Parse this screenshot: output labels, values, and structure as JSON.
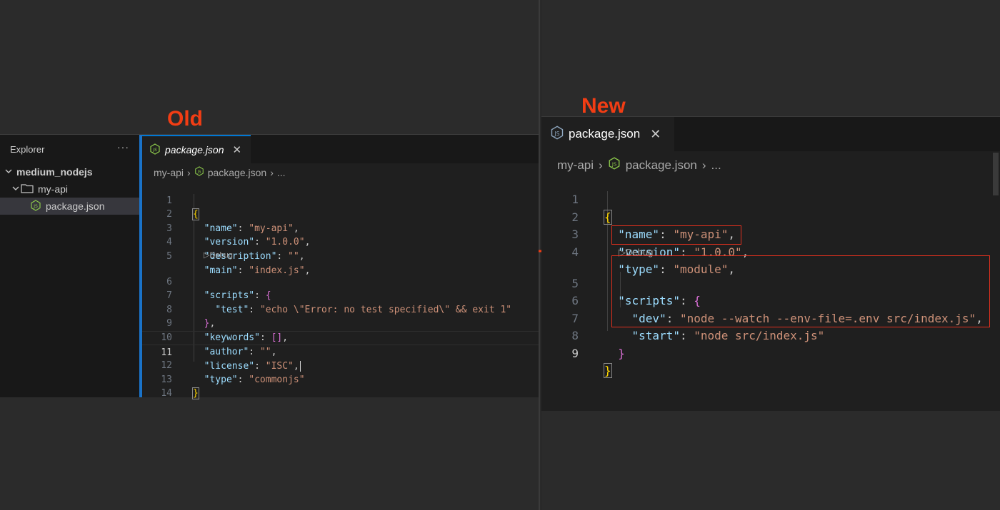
{
  "labels": {
    "old": "Old",
    "new": "New"
  },
  "colors": {
    "accent_label": "#f23d14",
    "highlight_box": "#e0301e",
    "tab_active_border": "#0078d4"
  },
  "old": {
    "explorer": {
      "title": "Explorer",
      "more": "···",
      "items": [
        {
          "label": "medium_nodejs",
          "type": "folder-root",
          "icon": "chevron-down-icon"
        },
        {
          "label": "my-api",
          "type": "folder",
          "icon": "folder-icon"
        },
        {
          "label": "package.json",
          "type": "file",
          "icon": "js-file-icon",
          "selected": true
        }
      ]
    },
    "tab": {
      "label": "package.json",
      "close": "✕",
      "icon": "js-file-icon"
    },
    "breadcrumb": [
      "my-api",
      "package.json",
      "..."
    ],
    "debug_label": "▷Debug",
    "lines": [
      "1",
      "2",
      "3",
      "4",
      "5",
      "6",
      "7",
      "8",
      "9",
      "10",
      "11",
      "12",
      "13",
      "14"
    ],
    "active_line": "11",
    "code": {
      "name_key": "\"name\"",
      "name_val": "\"my-api\"",
      "version_key": "\"version\"",
      "version_val": "\"1.0.0\"",
      "description_key": "\"description\"",
      "description_val": "\"\"",
      "main_key": "\"main\"",
      "main_val": "\"index.js\"",
      "scripts_key": "\"scripts\"",
      "test_key": "\"test\"",
      "test_val": "\"echo \\\"Error: no test specified\\\" && exit 1\"",
      "keywords_key": "\"keywords\"",
      "keywords_val": "[]",
      "author_key": "\"author\"",
      "author_val": "\"\"",
      "license_key": "\"license\"",
      "license_val": "\"ISC\"",
      "type_key": "\"type\"",
      "type_val": "\"commonjs\""
    }
  },
  "new": {
    "tab": {
      "label": "package.json",
      "close": "✕",
      "icon": "js-file-icon"
    },
    "breadcrumb": [
      "my-api",
      "package.json",
      "..."
    ],
    "debug_label": "▷Debug",
    "lines": [
      "1",
      "2",
      "3",
      "4",
      "5",
      "6",
      "7",
      "8",
      "9"
    ],
    "active_line": "9",
    "code": {
      "name_key": "\"name\"",
      "name_val": "\"my-api\"",
      "version_key": "\"version\"",
      "version_val": "\"1.0.0\"",
      "type_key": "\"type\"",
      "type_val": "\"module\"",
      "scripts_key": "\"scripts\"",
      "dev_key": "\"dev\"",
      "dev_val": "\"node --watch --env-file=.env src/index.js\"",
      "start_key": "\"start\"",
      "start_val": "\"node src/index.js\""
    }
  }
}
